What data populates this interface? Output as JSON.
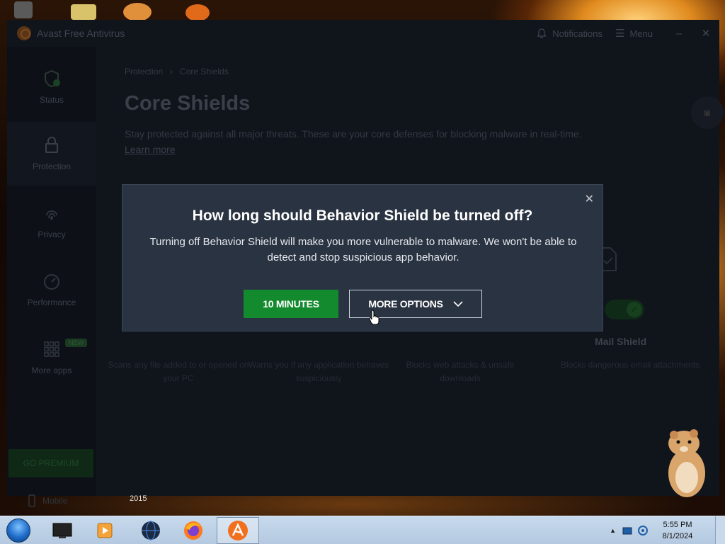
{
  "app": {
    "title": "Avast Free Antivirus",
    "notifications_label": "Notifications",
    "menu_label": "Menu"
  },
  "sidebar": {
    "items": [
      {
        "label": "Status",
        "icon": "shield-check-icon"
      },
      {
        "label": "Protection",
        "icon": "lock-icon"
      },
      {
        "label": "Privacy",
        "icon": "fingerprint-icon"
      },
      {
        "label": "Performance",
        "icon": "gauge-icon"
      },
      {
        "label": "More apps",
        "icon": "grid-icon",
        "badge": "NEW"
      }
    ],
    "premium_label": "GO PREMIUM",
    "mobile_label": "Mobile"
  },
  "main": {
    "breadcrumb": [
      "Protection",
      "Core Shields"
    ],
    "title": "Core Shields",
    "description": "Stay protected against all major threats. These are your core defenses for blocking malware in real-time.",
    "learn_more": "Learn more",
    "shields": [
      {
        "desc": "Scans any file added to or opened on your PC"
      },
      {
        "desc": "Warns you if any application behaves suspiciously"
      },
      {
        "desc": "Blocks web attacks & unsafe downloads"
      },
      {
        "name": "Mail Shield",
        "desc": "Blocks dangerous email attachments"
      }
    ]
  },
  "dialog": {
    "title": "How long should Behavior Shield be turned off?",
    "body": "Turning off Behavior Shield will make you more vulnerable to malware. We won't be able to detect and stop suspicious app behavior.",
    "primary_button": "10 MINUTES",
    "secondary_button": "MORE OPTIONS"
  },
  "desktop": {
    "year_label": "2015"
  },
  "taskbar": {
    "time": "5:55 PM",
    "date": "8/1/2024"
  },
  "colors": {
    "accent_green": "#138a2e",
    "dialog_bg": "#2a3342",
    "app_bg": "#10141b"
  }
}
